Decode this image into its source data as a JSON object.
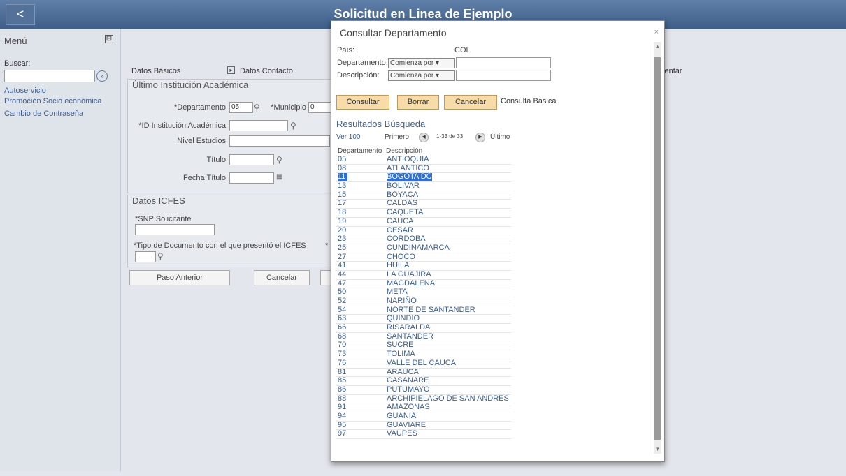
{
  "header": {
    "back_label": "<",
    "title": "Solicitud en Linea de Ejemplo"
  },
  "sidebar": {
    "menu_label": "Menú",
    "collapse_symbol": "⊟",
    "search_label": "Buscar:",
    "search_value": "",
    "go_symbol": "»",
    "items": [
      {
        "label": "Autoservicio"
      },
      {
        "label": "Promoción Socio económica"
      },
      {
        "label": "Cambio de Contraseña"
      }
    ]
  },
  "main": {
    "tabs": [
      {
        "label": "Datos Básicos"
      },
      {
        "label": "Datos Contacto"
      }
    ],
    "partial_tab": "sentar",
    "academic": {
      "title": "Último Institución Académica",
      "departamento_label": "*Departamento",
      "departamento_value": "05",
      "municipio_label": "*Municipio",
      "municipio_value": "0",
      "institucion_label": "*ID Institución Académica",
      "institucion_value": "",
      "nivel_label": "Nivel Estudios",
      "nivel_value": "",
      "titulo_label": "Título",
      "titulo_value": "",
      "fecha_label": "Fecha Título",
      "fecha_value": ""
    },
    "icfes": {
      "title": "Datos ICFES",
      "snp_label": "*SNP Solicitante",
      "snp_value": "",
      "tipo_label": "*Tipo de Documento con el que presentó el ICFES",
      "tipo_partial": "*",
      "tipo_value": ""
    },
    "buttons": {
      "prev": "Paso Anterior",
      "cancel": "Cancelar"
    }
  },
  "dialog": {
    "title": "Consultar Departamento",
    "close_symbol": "×",
    "pais_label": "País:",
    "pais_value": "COL",
    "depto_label": "Departamento:",
    "depto_op": "Comienza por",
    "depto_value": "",
    "desc_label": "Descripción:",
    "desc_op": "Comienza por",
    "desc_value": "",
    "buttons": {
      "consultar": "Consultar",
      "borrar": "Borrar",
      "cancelar": "Cancelar",
      "basica": "Consulta Básica"
    },
    "results_title": "Resultados Búsqueda",
    "nav": {
      "ver": "Ver 100",
      "primero": "Primero",
      "range": "1-33 de 33",
      "ultimo": "Último"
    },
    "columns": {
      "c1": "Departamento",
      "c2": "Descripción"
    },
    "rows": [
      {
        "code": "05",
        "name": "ANTIOQUIA"
      },
      {
        "code": "08",
        "name": "ATLANTICO"
      },
      {
        "code": "11",
        "name": "BOGOTA DC"
      },
      {
        "code": "13",
        "name": "BOLIVAR"
      },
      {
        "code": "15",
        "name": "BOYACA"
      },
      {
        "code": "17",
        "name": "CALDAS"
      },
      {
        "code": "18",
        "name": "CAQUETA"
      },
      {
        "code": "19",
        "name": "CAUCA"
      },
      {
        "code": "20",
        "name": "CESAR"
      },
      {
        "code": "23",
        "name": "CORDOBA"
      },
      {
        "code": "25",
        "name": "CUNDINAMARCA"
      },
      {
        "code": "27",
        "name": "CHOCO"
      },
      {
        "code": "41",
        "name": "HUILA"
      },
      {
        "code": "44",
        "name": "LA GUAJIRA"
      },
      {
        "code": "47",
        "name": "MAGDALENA"
      },
      {
        "code": "50",
        "name": "META"
      },
      {
        "code": "52",
        "name": "NARIÑO"
      },
      {
        "code": "54",
        "name": "NORTE DE SANTANDER"
      },
      {
        "code": "63",
        "name": "QUINDIO"
      },
      {
        "code": "66",
        "name": "RISARALDA"
      },
      {
        "code": "68",
        "name": "SANTANDER"
      },
      {
        "code": "70",
        "name": "SUCRE"
      },
      {
        "code": "73",
        "name": "TOLIMA"
      },
      {
        "code": "76",
        "name": "VALLE DEL CAUCA"
      },
      {
        "code": "81",
        "name": "ARAUCA"
      },
      {
        "code": "85",
        "name": "CASANARE"
      },
      {
        "code": "86",
        "name": "PUTUMAYO"
      },
      {
        "code": "88",
        "name": "ARCHIPIELAGO DE SAN ANDRES"
      },
      {
        "code": "91",
        "name": "AMAZONAS"
      },
      {
        "code": "94",
        "name": "GUANIA"
      },
      {
        "code": "95",
        "name": "GUAVIARE"
      },
      {
        "code": "97",
        "name": "VAUPES"
      }
    ]
  }
}
